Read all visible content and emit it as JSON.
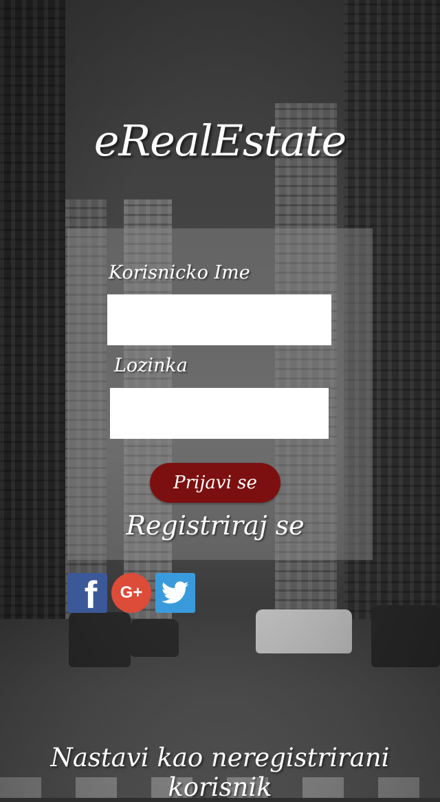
{
  "app": {
    "logo_text": "eRealEstate"
  },
  "login_form": {
    "username_label": "Korisnicko Ime",
    "username_value": "",
    "password_label": "Lozinka",
    "password_value": "",
    "login_button_label": "Prijavi se",
    "register_link_label": "Registriraj se"
  },
  "social": {
    "items": [
      {
        "name": "facebook",
        "icon": "facebook-icon",
        "glyph": "f",
        "color": "#3b5998"
      },
      {
        "name": "google_plus",
        "icon": "google-plus-icon",
        "glyph": "G+",
        "color": "#dd4b39"
      },
      {
        "name": "twitter",
        "icon": "twitter-icon",
        "color": "#3a9bdc"
      }
    ]
  },
  "footer": {
    "guest_link_label": "Nastavi kao neregistrirani korisnik"
  },
  "colors": {
    "login_button": "#7c1010",
    "panel": "rgba(140,140,140,0.45)"
  }
}
